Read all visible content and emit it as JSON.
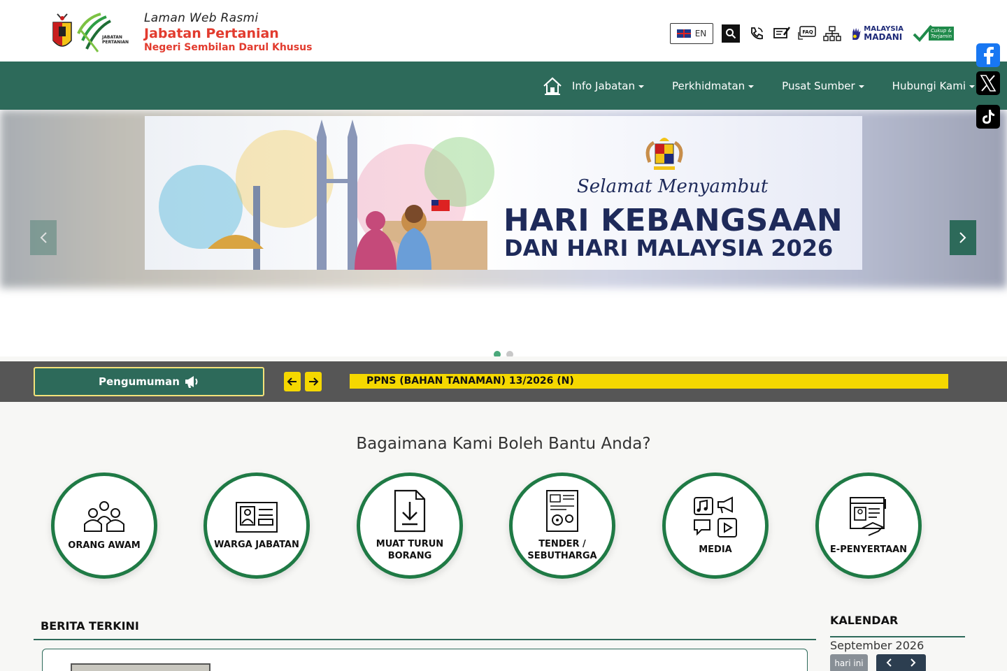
{
  "header": {
    "title_line1": "Laman Web Rasmi",
    "title_line2": "Jabatan Pertanian",
    "title_line3": "Negeri Sembilan Darul Khusus",
    "logo_text": "JABATAN PERTANIAN",
    "lang_label": "EN",
    "faq_label": "FAQ",
    "madani_line1": "MALAYSIA",
    "madani_line2": "MADANI",
    "cukup_line1": "Cukup &",
    "cukup_line2": "Terjamin"
  },
  "nav": {
    "items": [
      {
        "label": "Info Jabatan"
      },
      {
        "label": "Perkhidmatan"
      },
      {
        "label": "Pusat Sumber"
      },
      {
        "label": "Hubungi Kami"
      }
    ]
  },
  "slider": {
    "selamat": "Selamat Menyambut",
    "headline1": "HARI KEBANGSAAN",
    "headline2": "DAN HARI MALAYSIA 2026"
  },
  "announcement": {
    "button_label": "Pengumuman",
    "ticker": "PPNS (BAHAN TANAMAN) 13/2026 (N)"
  },
  "help": {
    "title": "Bagaimana Kami Boleh Bantu Anda?",
    "items": [
      {
        "line1": "ORANG AWAM",
        "line2": ""
      },
      {
        "line1": "WARGA JABATAN",
        "line2": ""
      },
      {
        "line1": "MUAT TURUN",
        "line2": "BORANG"
      },
      {
        "line1": "TENDER /",
        "line2": "SEBUTHARGA"
      },
      {
        "line1": "MEDIA",
        "line2": ""
      },
      {
        "line1": "E-PENYERTAAN",
        "line2": ""
      }
    ]
  },
  "news": {
    "title": "BERITA TERKINI"
  },
  "calendar": {
    "title": "KALENDAR",
    "month": "September 2026",
    "today_label": "hari ini"
  },
  "colors": {
    "brand_green": "#2d6a5a",
    "accent_yellow": "#f5d800",
    "circle_border": "#1f7a45",
    "title_red": "#e23b2e"
  }
}
